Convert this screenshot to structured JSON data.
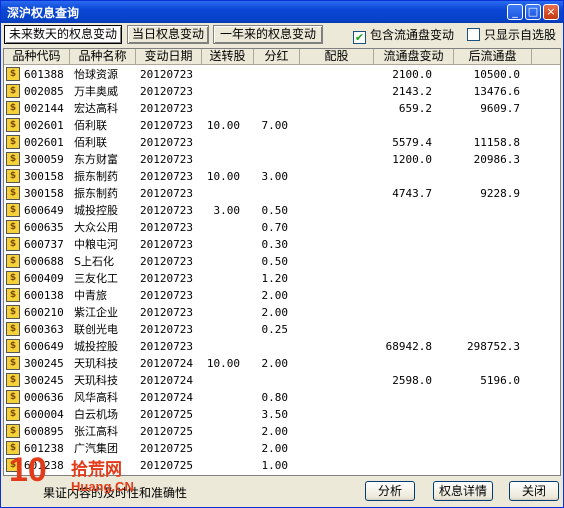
{
  "window": {
    "title": "深沪权息查询",
    "minimize_glyph": "_",
    "maximize_glyph": "□",
    "close_glyph": "×"
  },
  "tabs": [
    {
      "label": "未来数天的权息变动"
    },
    {
      "label": "当日权息变动"
    },
    {
      "label": "一年来的权息变动"
    }
  ],
  "filters": {
    "include_float": {
      "label": "包含流通盘变动",
      "checked": true
    },
    "self_select_only": {
      "label": "只显示自选股",
      "checked": false
    }
  },
  "table": {
    "columns": [
      "品种代码",
      "品种名称",
      "变动日期",
      "送转股",
      "分红",
      "配股",
      "流通盘变动",
      "后流通盘"
    ],
    "rows": [
      {
        "code": "601388",
        "name": "怡球资源",
        "date": "20120723",
        "song": "",
        "fenhong": "",
        "peigu": "",
        "float_change": "2100.0",
        "after_float": "10500.0"
      },
      {
        "code": "002085",
        "name": "万丰奥威",
        "date": "20120723",
        "song": "",
        "fenhong": "",
        "peigu": "",
        "float_change": "2143.2",
        "after_float": "13476.6"
      },
      {
        "code": "002144",
        "name": "宏达高科",
        "date": "20120723",
        "song": "",
        "fenhong": "",
        "peigu": "",
        "float_change": "659.2",
        "after_float": "9609.7"
      },
      {
        "code": "002601",
        "name": "佰利联",
        "date": "20120723",
        "song": "10.00",
        "fenhong": "7.00",
        "peigu": "",
        "float_change": "",
        "after_float": ""
      },
      {
        "code": "002601",
        "name": "佰利联",
        "date": "20120723",
        "song": "",
        "fenhong": "",
        "peigu": "",
        "float_change": "5579.4",
        "after_float": "11158.8"
      },
      {
        "code": "300059",
        "name": "东方财富",
        "date": "20120723",
        "song": "",
        "fenhong": "",
        "peigu": "",
        "float_change": "1200.0",
        "after_float": "20986.3"
      },
      {
        "code": "300158",
        "name": "振东制药",
        "date": "20120723",
        "song": "10.00",
        "fenhong": "3.00",
        "peigu": "",
        "float_change": "",
        "after_float": ""
      },
      {
        "code": "300158",
        "name": "振东制药",
        "date": "20120723",
        "song": "",
        "fenhong": "",
        "peigu": "",
        "float_change": "4743.7",
        "after_float": "9228.9"
      },
      {
        "code": "600649",
        "name": "城投控股",
        "date": "20120723",
        "song": "3.00",
        "fenhong": "0.50",
        "peigu": "",
        "float_change": "",
        "after_float": ""
      },
      {
        "code": "600635",
        "name": "大众公用",
        "date": "20120723",
        "song": "",
        "fenhong": "0.70",
        "peigu": "",
        "float_change": "",
        "after_float": ""
      },
      {
        "code": "600737",
        "name": "中粮屯河",
        "date": "20120723",
        "song": "",
        "fenhong": "0.30",
        "peigu": "",
        "float_change": "",
        "after_float": ""
      },
      {
        "code": "600688",
        "name": "S上石化",
        "date": "20120723",
        "song": "",
        "fenhong": "0.50",
        "peigu": "",
        "float_change": "",
        "after_float": ""
      },
      {
        "code": "600409",
        "name": "三友化工",
        "date": "20120723",
        "song": "",
        "fenhong": "1.20",
        "peigu": "",
        "float_change": "",
        "after_float": ""
      },
      {
        "code": "600138",
        "name": "中青旅",
        "date": "20120723",
        "song": "",
        "fenhong": "2.00",
        "peigu": "",
        "float_change": "",
        "after_float": ""
      },
      {
        "code": "600210",
        "name": "紫江企业",
        "date": "20120723",
        "song": "",
        "fenhong": "2.00",
        "peigu": "",
        "float_change": "",
        "after_float": ""
      },
      {
        "code": "600363",
        "name": "联创光电",
        "date": "20120723",
        "song": "",
        "fenhong": "0.25",
        "peigu": "",
        "float_change": "",
        "after_float": ""
      },
      {
        "code": "600649",
        "name": "城投控股",
        "date": "20120723",
        "song": "",
        "fenhong": "",
        "peigu": "",
        "float_change": "68942.8",
        "after_float": "298752.3"
      },
      {
        "code": "300245",
        "name": "天玑科技",
        "date": "20120724",
        "song": "10.00",
        "fenhong": "2.00",
        "peigu": "",
        "float_change": "",
        "after_float": ""
      },
      {
        "code": "300245",
        "name": "天玑科技",
        "date": "20120724",
        "song": "",
        "fenhong": "",
        "peigu": "",
        "float_change": "2598.0",
        "after_float": "5196.0"
      },
      {
        "code": "000636",
        "name": "风华高科",
        "date": "20120724",
        "song": "",
        "fenhong": "0.80",
        "peigu": "",
        "float_change": "",
        "after_float": ""
      },
      {
        "code": "600004",
        "name": "白云机场",
        "date": "20120725",
        "song": "",
        "fenhong": "3.50",
        "peigu": "",
        "float_change": "",
        "after_float": ""
      },
      {
        "code": "600895",
        "name": "张江高科",
        "date": "20120725",
        "song": "",
        "fenhong": "2.00",
        "peigu": "",
        "float_change": "",
        "after_float": ""
      },
      {
        "code": "601238",
        "name": "广汽集团",
        "date": "20120725",
        "song": "",
        "fenhong": "2.00",
        "peigu": "",
        "float_change": "",
        "after_float": ""
      },
      {
        "code": "601238",
        "name": "",
        "date": "20120725",
        "song": "",
        "fenhong": "1.00",
        "peigu": "",
        "float_change": "",
        "after_float": ""
      }
    ]
  },
  "status": {
    "text": "果证内容的及时性和准确性"
  },
  "buttons": {
    "analyze": "分析",
    "detail": "权息详情",
    "close": "关闭"
  },
  "watermark": {
    "number": "10",
    "cn": "拾荒网",
    "en": "Huang.CN"
  }
}
